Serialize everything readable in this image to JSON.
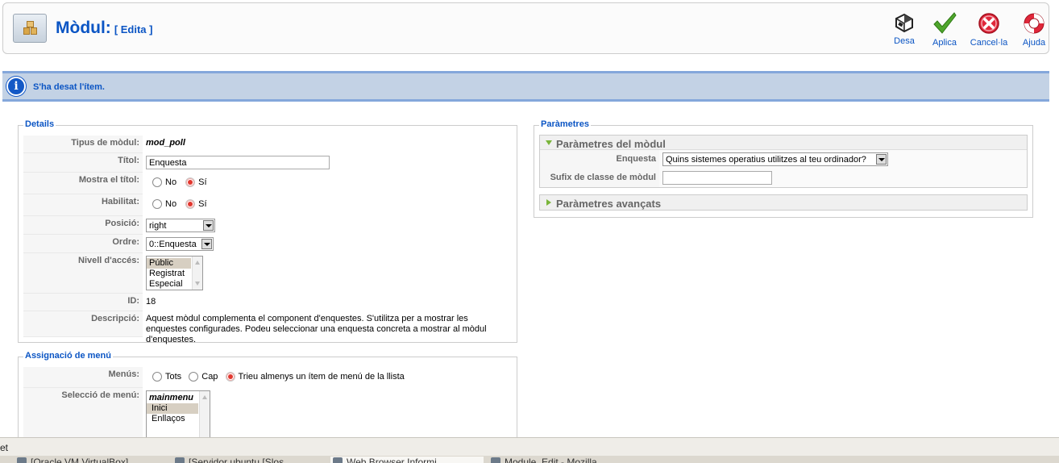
{
  "header": {
    "title": "Mòdul:",
    "subtitle": "[ Edita ]",
    "module_icon": "module-box-icon"
  },
  "toolbar": {
    "save_label": "Desa",
    "apply_label": "Aplica",
    "cancel_label": "Cancel·la",
    "help_label": "Ajuda"
  },
  "message": {
    "text": "S'ha desat l'ítem."
  },
  "details": {
    "legend": "Details",
    "module_type_label": "Tipus de mòdul:",
    "module_type_value": "mod_poll",
    "title_label": "Títol:",
    "title_value": "Enquesta",
    "show_title_label": "Mostra el títol:",
    "show_title_options": [
      "No",
      "Sí"
    ],
    "show_title_selected": "Sí",
    "enabled_label": "Habilitat:",
    "enabled_options": [
      "No",
      "Sí"
    ],
    "enabled_selected": "Sí",
    "position_label": "Posició:",
    "position_value": "right",
    "order_label": "Ordre:",
    "order_value": "0::Enquesta",
    "access_label": "Nivell d'accés:",
    "access_options": [
      "Públic",
      "Registrat",
      "Especial"
    ],
    "access_selected": "Públic",
    "id_label": "ID:",
    "id_value": "18",
    "description_label": "Descripció:",
    "description_value": "Aquest mòdul complementa el component d'enquestes. S'utilitza per a mostrar les enquestes configurades. Podeu seleccionar una enquesta concreta a mostrar al mòdul d'enquestes."
  },
  "menu_assignment": {
    "legend": "Assignació de menú",
    "menus_label": "Menús:",
    "menus_options": [
      "Tots",
      "Cap",
      "Trieu almenys un ítem de menú de la llista"
    ],
    "menus_selected": "Trieu almenys un ítem de menú de la llista",
    "menu_selection_label": "Selecció de menú:",
    "menu_selection_items": [
      "mainmenu",
      "Inici",
      "Enllaços"
    ]
  },
  "params": {
    "legend": "Paràmetres",
    "module_params_title": "Paràmetres del mòdul",
    "poll_label": "Enquesta",
    "poll_value": "Quins sistemes operatius utilitzes al teu ordinador?",
    "suffix_label": "Sufix de classe de mòdul",
    "suffix_value": "",
    "advanced_title": "Paràmetres avançats"
  },
  "statusbar": {
    "text": "et"
  },
  "taskbar": {
    "items": [
      "[Oracle VM VirtualBox]",
      "[Servidor ubuntu [Slos",
      "Web Browser Informi",
      "Module_Edit - Mozilla"
    ]
  },
  "colors": {
    "accent": "#0b55c4",
    "message_bg": "#c3d2e5",
    "radio_on": "#e2372f"
  }
}
